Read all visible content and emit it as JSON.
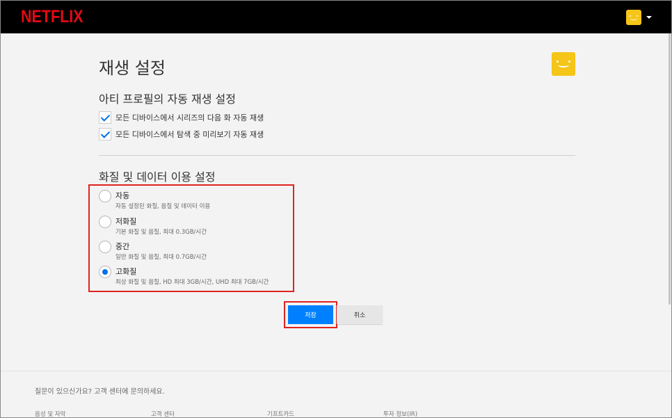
{
  "header": {
    "logo": "NETFLIX",
    "avatar_icon": "smiley-avatar-icon",
    "menu_icon": "caret-down-icon"
  },
  "page": {
    "title": "재생 설정"
  },
  "autoplay": {
    "title": "아티 프로필의 자동 재생 설정",
    "options": [
      {
        "label": "모든 디바이스에서 시리즈의 다음 화 자동 재생",
        "checked": true
      },
      {
        "label": "모든 디바이스에서 탐색 중 미리보기 자동 재생",
        "checked": true
      }
    ]
  },
  "quality": {
    "title": "화질 및 데이터 이용 설정",
    "options": [
      {
        "label": "자동",
        "desc": "자동 설정된 화질, 음질 및 데이터 이용",
        "selected": false
      },
      {
        "label": "저화질",
        "desc": "기본 화질 및 음질, 최대 0.3GB/시간",
        "selected": false
      },
      {
        "label": "중간",
        "desc": "일반 화질 및 음질, 최대 0.7GB/시간",
        "selected": false
      },
      {
        "label": "고화질",
        "desc": "최상 화질 및 음질, HD 최대 3GB/시간, UHD 최대 7GB/시간",
        "selected": true
      }
    ]
  },
  "actions": {
    "save": "저장",
    "cancel": "취소"
  },
  "footer": {
    "question": "질문이 있으신가요? 고객 센터에 문의하세요.",
    "links": [
      "음성 및 자막",
      "고객 센터",
      "기프트카드",
      "투자 정보(IR)"
    ]
  },
  "colors": {
    "brand": "#e50914",
    "accent": "#0080ff",
    "highlight": "#e0221e",
    "avatar": "#f5c518"
  }
}
